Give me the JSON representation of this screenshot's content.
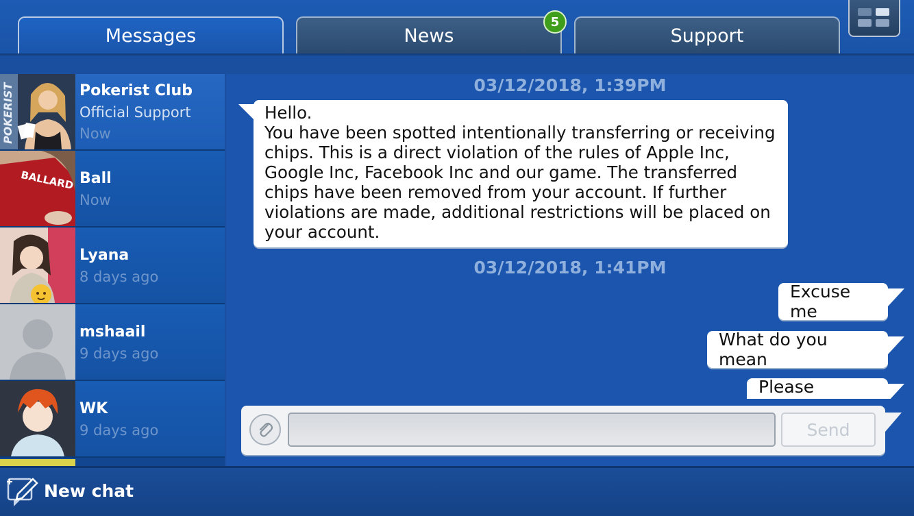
{
  "tabs": {
    "messages": "Messages",
    "news": "News",
    "support": "Support",
    "news_badge": "5"
  },
  "contacts": [
    {
      "name": "Pokerist Club",
      "subtitle": "Official Support",
      "time": "Now",
      "avatar_text": "POKERIST"
    },
    {
      "name": "Ball",
      "time": "Now",
      "avatar_text": "BALLARD"
    },
    {
      "name": "Lyana",
      "time": "8 days ago"
    },
    {
      "name": "mshaail",
      "time": "9 days ago"
    },
    {
      "name": "WK",
      "time": "9 days ago"
    }
  ],
  "chat": {
    "date1": "03/12/2018, 1:39PM",
    "incoming_message": "Hello.\nYou have been spotted intentionally transferring or receiving chips. This is a direct violation of the rules of Apple Inc, Google Inc, Facebook Inc and our game. The transferred chips have been removed from your account. If further violations are made, additional restrictions will be placed on your account.",
    "date2": "03/12/2018, 1:41PM",
    "outgoing": [
      "Excuse me",
      "What do you mean",
      "Please explain"
    ]
  },
  "compose": {
    "input_value": "",
    "send_label": "Send"
  },
  "footer": {
    "new_chat_label": "New chat"
  },
  "icons": {
    "attach": "paperclip-icon",
    "new_chat": "compose-pencil-icon",
    "menu": "grid-menu-icon"
  },
  "colors": {
    "background_blue": "#1b55ad",
    "badge_green": "#3f9e1c",
    "date_text": "#8fb0dd"
  }
}
